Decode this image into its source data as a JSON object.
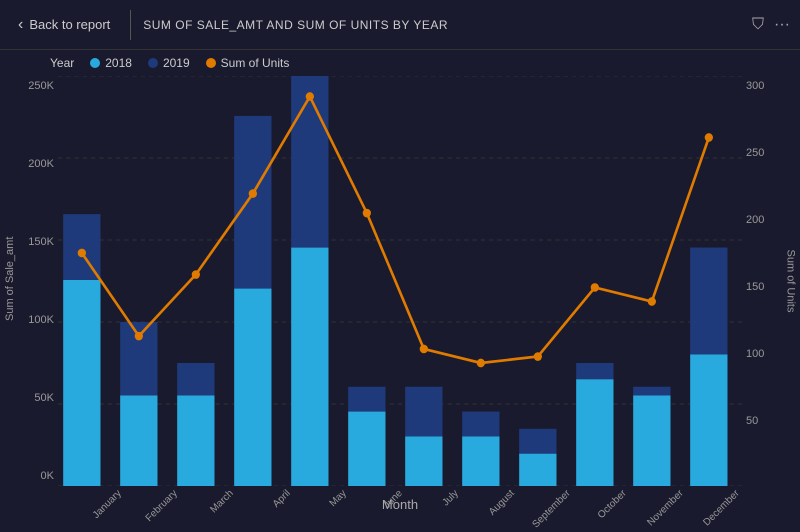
{
  "header": {
    "back_label": "Back to report",
    "chart_title": "SUM OF SALE_AMT AND SUM OF UNITS BY YEAR",
    "filter_icon": "⛉",
    "more_icon": "···"
  },
  "legend": {
    "year_label": "Year",
    "items": [
      {
        "label": "2018",
        "color": "#29aadf"
      },
      {
        "label": "2019",
        "color": "#1e3a7a"
      },
      {
        "label": "Sum of Units",
        "color": "#e07b00"
      }
    ]
  },
  "yaxis_left": {
    "label": "Sum of Sale_amt",
    "ticks": [
      "250K",
      "200K",
      "150K",
      "100K",
      "50K",
      "0K"
    ]
  },
  "yaxis_right": {
    "label": "Sum of Units",
    "ticks": [
      "300",
      "250",
      "200",
      "150",
      "100",
      "50",
      ""
    ]
  },
  "x_label": "Month",
  "months": [
    "January",
    "February",
    "March",
    "April",
    "May",
    "June",
    "July",
    "August",
    "September",
    "October",
    "November",
    "December"
  ],
  "bars": {
    "data_2018": [
      125000,
      55000,
      55000,
      120000,
      145000,
      45000,
      30000,
      30000,
      20000,
      65000,
      55000,
      80000
    ],
    "data_2019": [
      40000,
      45000,
      20000,
      105000,
      110000,
      15000,
      30000,
      15000,
      15000,
      10000,
      5000,
      65000
    ],
    "units": [
      170,
      110,
      155,
      230,
      285,
      200,
      100,
      90,
      95,
      145,
      135,
      255
    ]
  },
  "colors": {
    "bar_2018": "#29aadf",
    "bar_2019": "#1e3a7a",
    "line_units": "#e07b00",
    "background": "#1a1a2e",
    "grid": "#333333"
  }
}
